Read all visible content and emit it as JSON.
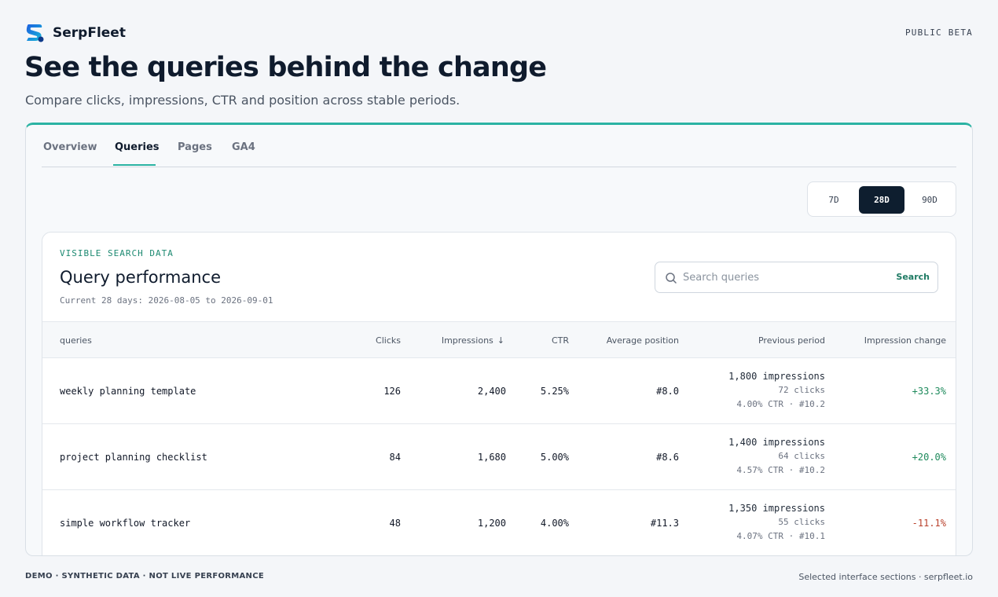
{
  "brand": {
    "name": "SerpFleet",
    "logo_icon": "serpfleet-logo-icon",
    "badge": "PUBLIC BETA"
  },
  "hero": {
    "title": "See the queries behind the change",
    "subtitle": "Compare clicks, impressions, CTR and position across stable periods."
  },
  "colors": {
    "accent": "#2bb3a3",
    "dark": "#0e1e2f",
    "positive": "#1e8a5c",
    "negative": "#b9412c"
  },
  "tabs": [
    {
      "label": "Overview",
      "active": false
    },
    {
      "label": "Queries",
      "active": true
    },
    {
      "label": "Pages",
      "active": false
    },
    {
      "label": "GA4",
      "active": false
    }
  ],
  "range": {
    "options": [
      "7D",
      "28D",
      "90D"
    ],
    "selected": "28D"
  },
  "panel": {
    "eyebrow": "VISIBLE SEARCH DATA",
    "title": "Query performance",
    "daterange": "Current 28 days: 2026-08-05 to 2026-09-01",
    "search": {
      "placeholder": "Search queries",
      "button": "Search",
      "icon": "search-icon"
    }
  },
  "table": {
    "headers": {
      "queries": "queries",
      "clicks": "Clicks",
      "impressions": "Impressions",
      "ctr": "CTR",
      "position": "Average position",
      "previous": "Previous period",
      "change": "Impression change"
    },
    "sort_icon": "arrow-down-icon",
    "rows": [
      {
        "query": "weekly planning template",
        "clicks": "126",
        "impressions": "2,400",
        "ctr": "5.25%",
        "position": "#8.0",
        "prev_impressions": "1,800 impressions",
        "prev_clicks": "72 clicks",
        "prev_meta": "4.00% CTR · #10.2",
        "change": "+33.3%",
        "trend": "up"
      },
      {
        "query": "project planning checklist",
        "clicks": "84",
        "impressions": "1,680",
        "ctr": "5.00%",
        "position": "#8.6",
        "prev_impressions": "1,400 impressions",
        "prev_clicks": "64 clicks",
        "prev_meta": "4.57% CTR · #10.2",
        "change": "+20.0%",
        "trend": "up"
      },
      {
        "query": "simple workflow tracker",
        "clicks": "48",
        "impressions": "1,200",
        "ctr": "4.00%",
        "position": "#11.3",
        "prev_impressions": "1,350 impressions",
        "prev_clicks": "55 clicks",
        "prev_meta": "4.07% CTR · #10.1",
        "change": "-11.1%",
        "trend": "down"
      }
    ]
  },
  "footer": {
    "left": "DEMO · SYNTHETIC DATA · NOT LIVE PERFORMANCE",
    "right": "Selected interface sections · serpfleet.io"
  }
}
